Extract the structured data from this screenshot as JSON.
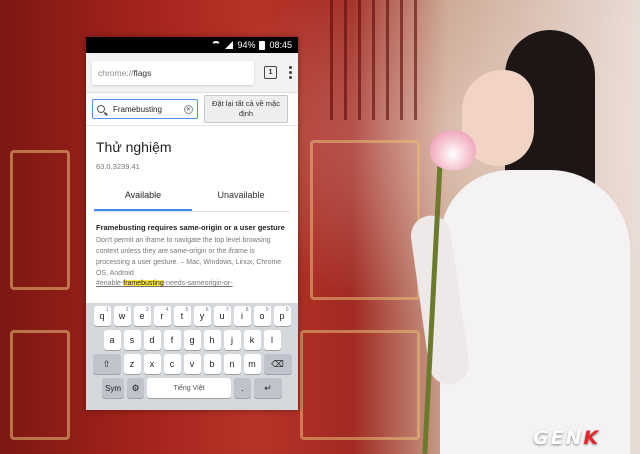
{
  "status_bar": {
    "battery": "94%",
    "time": "08:45"
  },
  "browser": {
    "url_scheme": "chrome://",
    "url_path": "flags",
    "tab_count": "1"
  },
  "flags_page": {
    "search": {
      "value": "Framebusting"
    },
    "reset_button": "Đặt lại tất cả về mặc định",
    "title": "Thử nghiệm",
    "version": "63.0.3239.41",
    "tabs": [
      {
        "label": "Available",
        "active": true
      },
      {
        "label": "Unavailable",
        "active": false
      }
    ],
    "experiment": {
      "title": "Framebusting requires same-origin or a user gesture",
      "description": "Don't permit an iframe to navigate the top level browsing context unless they are same-origin or the iframe is processing a user gesture. – Mac, Windows, Linux, Chrome OS, Android",
      "link_prefix": "#enable-",
      "link_highlight": "framebusting",
      "link_suffix": "-needs-sameorigin-or-"
    }
  },
  "keyboard": {
    "row1": [
      {
        "k": "q",
        "s": "1"
      },
      {
        "k": "w",
        "s": "2"
      },
      {
        "k": "e",
        "s": "3"
      },
      {
        "k": "r",
        "s": "4"
      },
      {
        "k": "t",
        "s": "5"
      },
      {
        "k": "y",
        "s": "6"
      },
      {
        "k": "u",
        "s": "7"
      },
      {
        "k": "i",
        "s": "8"
      },
      {
        "k": "o",
        "s": "9"
      },
      {
        "k": "p",
        "s": "0"
      }
    ],
    "row2": [
      "a",
      "s",
      "d",
      "f",
      "g",
      "h",
      "j",
      "k",
      "l"
    ],
    "row3": [
      "z",
      "x",
      "c",
      "v",
      "b",
      "n",
      "m"
    ],
    "shift": "⇧",
    "backspace": "⌫",
    "sym": "Sym",
    "settings": "⚙",
    "space": "Tiếng Việt",
    "period": ".",
    "enter": "↵"
  },
  "watermark": "GENK"
}
